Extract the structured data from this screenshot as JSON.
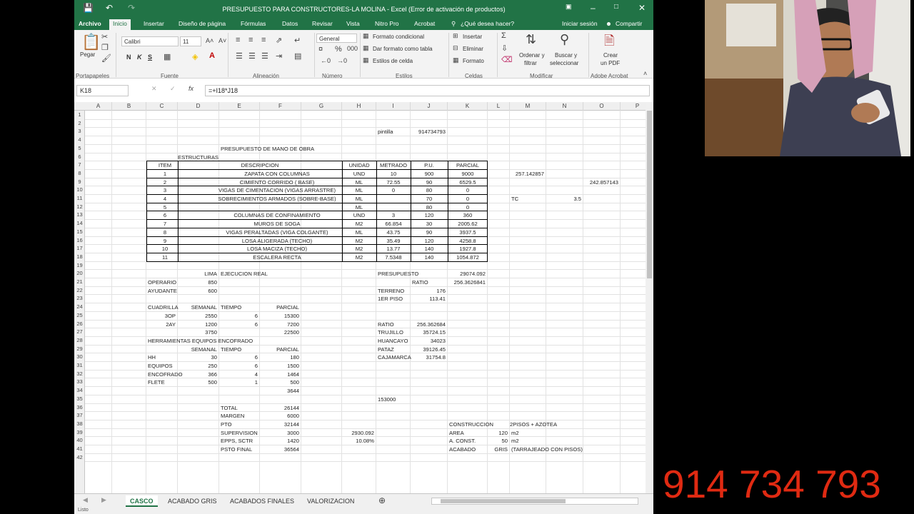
{
  "window": {
    "title": "PRESUPUESTO PARA CONSTRUCTORES-LA MOLINA - Excel (Error de activación de productos)"
  },
  "ribbon_tabs": [
    "Archivo",
    "Inicio",
    "Insertar",
    "Diseño de página",
    "Fórmulas",
    "Datos",
    "Revisar",
    "Vista",
    "Nitro Pro",
    "Acrobat"
  ],
  "tell_me": "¿Qué desea hacer?",
  "signin": "Iniciar sesión",
  "share": "Compartir",
  "ribbon": {
    "paste": "Pegar",
    "font_name": "Calibri",
    "font_size": "11",
    "bold": "N",
    "italic": "K",
    "underline": "S",
    "number_format": "General",
    "cond_format": "Formato condicional",
    "table_format": "Dar formato como tabla",
    "cell_styles": "Estilos de celda",
    "insert": "Insertar",
    "delete": "Eliminar",
    "format": "Formato",
    "sort1": "Ordenar y",
    "sort2": "filtrar",
    "find1": "Buscar y",
    "find2": "seleccionar",
    "pdf1": "Crear",
    "pdf2": "un PDF",
    "groups": [
      "Portapapeles",
      "Fuente",
      "Alineación",
      "Número",
      "Estilos",
      "Celdas",
      "Modificar",
      "Adobe Acrobat"
    ]
  },
  "name_box": "K18",
  "formula": "=+I18*J18",
  "columns": [
    "A",
    "B",
    "C",
    "D",
    "E",
    "F",
    "G",
    "H",
    "I",
    "J",
    "K",
    "L",
    "M",
    "N",
    "O",
    "P"
  ],
  "rows": [
    "1",
    "2",
    "3",
    "4",
    "5",
    "6",
    "7",
    "8",
    "9",
    "10",
    "11",
    "12",
    "13",
    "14",
    "15",
    "16",
    "17",
    "18",
    "19",
    "20",
    "21",
    "22",
    "23",
    "24",
    "25",
    "26",
    "27",
    "28",
    "29",
    "30",
    "31",
    "32",
    "33",
    "34",
    "35",
    "36",
    "37",
    "38",
    "39",
    "40",
    "41",
    "42"
  ],
  "cells": {
    "I3": "pintilla",
    "J3": "914734793",
    "E5": "PRESUPUESTO DE MANO DE OBRA",
    "D6": "ESTRUCTURAS",
    "C7": "ITEM",
    "E7": "DESCRIPCION",
    "H7": "UNIDAD",
    "I7": "METRADO",
    "J7": "P.U.",
    "K7": "PARCIAL",
    "C8": "1",
    "E8": "ZAPATA CON COLUMNAS",
    "H8": "UND",
    "I8": "10",
    "J8": "900",
    "K8": "9000",
    "M8": "257.142857",
    "C9": "2",
    "E9": "CIMIENTO CORRIDO ( BASE)",
    "H9": "ML",
    "I9": "72.55",
    "J9": "90",
    "K9": "6529.5",
    "O9": "242.857143",
    "C10": "3",
    "E10": "VIGAS DE CIMENTACION (VIGAS ARRASTRE)",
    "H10": "ML",
    "I10": "0",
    "J10": "80",
    "K10": "0",
    "C11": "4",
    "E11": "SOBRECIMIENTOS ARMADOS (SOBRE-BASE)",
    "H11": "ML",
    "J11": "70",
    "K11": "0",
    "M11": "TC",
    "N11": "3.5",
    "C12": "5",
    "H12": "ML",
    "J12": "80",
    "K12": "0",
    "C13": "6",
    "E13": "COLUMNAS DE CONFINAMIENTO",
    "H13": "UND",
    "I13": "3",
    "J13": "120",
    "K13": "360",
    "C14": "7",
    "E14": "MUROS DE SOGA",
    "H14": "M2",
    "I14": "66.854",
    "J14": "30",
    "K14": "2005.62",
    "C15": "8",
    "E15": "VIGAS PERALTADAS (VIGA COLGANTE)",
    "H15": "ML",
    "I15": "43.75",
    "J15": "90",
    "K15": "3937.5",
    "C16": "9",
    "E16": "LOSA ALIGERADA (TECHO)",
    "H16": "M2",
    "I16": "35.49",
    "J16": "120",
    "K16": "4258.8",
    "C17": "10",
    "E17": "LOSA MACIZA (TECHO)",
    "H17": "M2",
    "I17": "13.77",
    "J17": "140",
    "K17": "1927.8",
    "C18": "11",
    "E18": "ESCALERA RECTA",
    "H18": "M2",
    "I18": "7.5348",
    "J18": "140",
    "K18": "1054.872",
    "D20": "LIMA",
    "E20": "EJECUCION REAL",
    "I20": "PRESUPUESTO",
    "K20": "29074.092",
    "C21": "OPERARIO",
    "D21": "850",
    "J21": "RATIO",
    "K21": "256.3626841",
    "C22": "AYUDANTE",
    "D22": "600",
    "I22": "TERRENO",
    "J22": "176",
    "I23": "1ER PISO",
    "J23": "113.41",
    "C24": "CUADRILLA",
    "D24": "SEMANAL",
    "E24": "TIEMPO",
    "F24": "PARCIAL",
    "C25": "3OP",
    "D25": "2550",
    "E25": "6",
    "F25": "15300",
    "C26": "2AY",
    "D26": "1200",
    "E26": "6",
    "F26": "7200",
    "I26": "RATIO",
    "J26": "256.362684",
    "D27": "3750",
    "F27": "22500",
    "I27": "TRUJILLO",
    "J27": "35724.15",
    "C28": "HERRAMIENTAS EQUIPOS ENCOFRADO",
    "I28": "HUANCAYO",
    "J28": "34023",
    "D29": "SEMANAL",
    "E29": "TIEMPO",
    "F29": "PARCIAL",
    "I29": "PATAZ",
    "J29": "39126.45",
    "C30": "HH",
    "D30": "30",
    "E30": "6",
    "F30": "180",
    "I30": "CAJAMARCA",
    "J30": "31754.8",
    "C31": "EQUIPOS",
    "D31": "250",
    "E31": "6",
    "F31": "1500",
    "C32": "ENCOFRADO",
    "D32": "366",
    "E32": "4",
    "F32": "1464",
    "C33": "FLETE",
    "D33": "500",
    "E33": "1",
    "F33": "500",
    "F34": "3644",
    "I35": "153000",
    "E36": "TOTAL",
    "F36": "26144",
    "E37": "MARGEN",
    "F37": "6000",
    "E38": "PTO",
    "F38": "32144",
    "K38": "CONSTRUCCION",
    "M38": "2PISOS + AZOTEA",
    "E39": "SUPERVISION",
    "F39": "3000",
    "H39": "2930.092",
    "K39": "AREA",
    "L39": "120",
    "M39": "m2",
    "E40": "EPPS, SCTR",
    "F40": "1420",
    "H40": "10.08%",
    "K40": "A. CONST.",
    "L40": "50",
    "M40": "m2",
    "E41": "PSTO FINAL",
    "F41": "36564",
    "K41": "ACABADO",
    "L41": "GRIS",
    "M41": "(TARRAJEADO CON PISOS)"
  },
  "sheet_tabs": [
    "CASCO",
    "ACABADO GRIS",
    "ACABADOS FINALES",
    "VALORIZACION"
  ],
  "status": "Listo",
  "overlay_phone": "914 734 793",
  "colors": {
    "excel_green": "#217346",
    "overlay_red": "#e02a12"
  }
}
